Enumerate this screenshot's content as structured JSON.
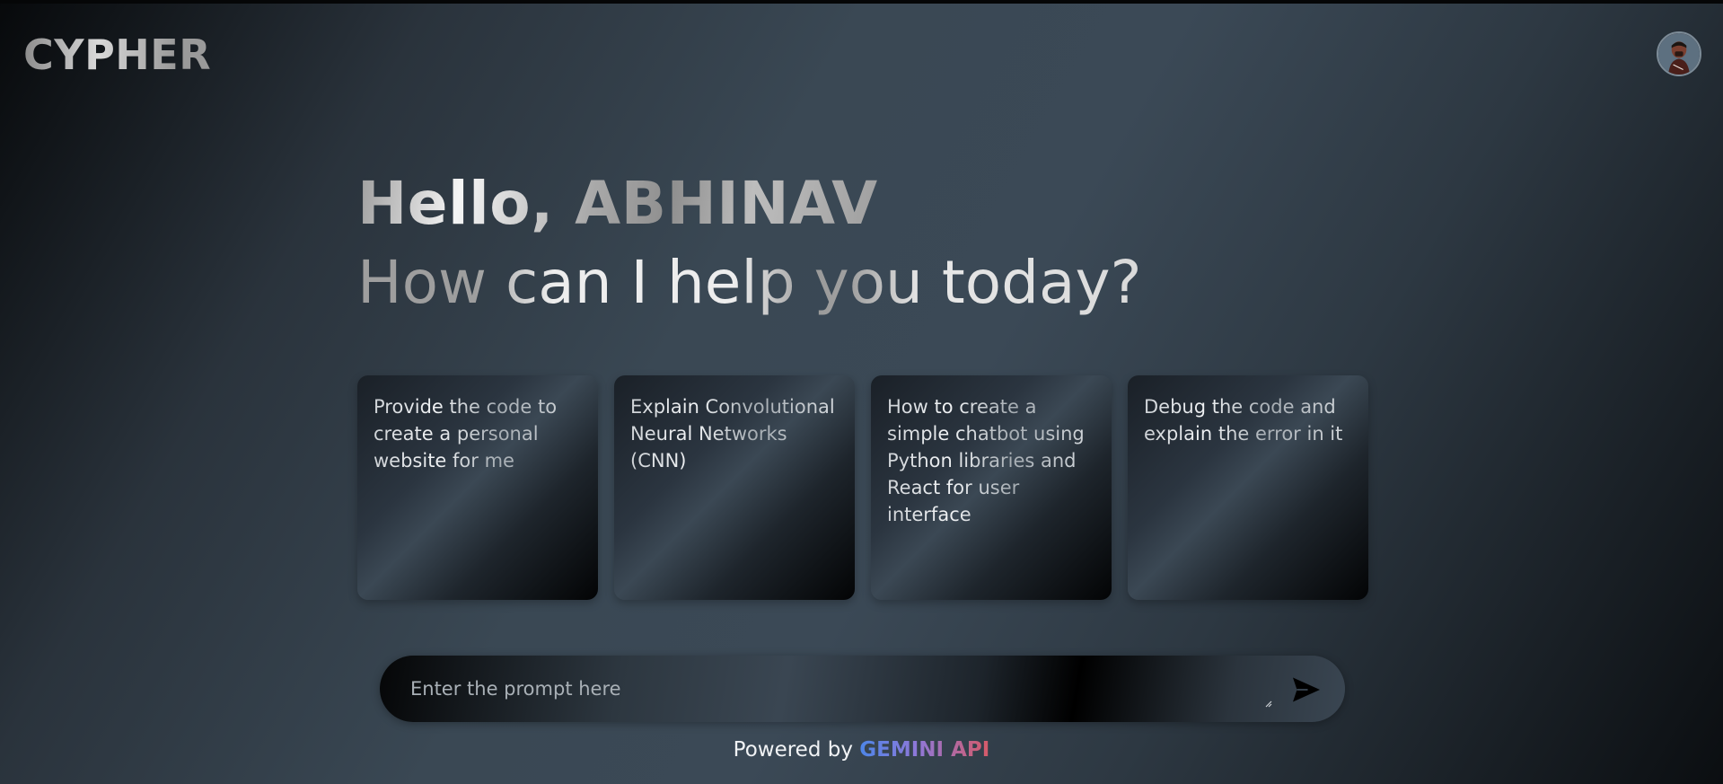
{
  "app": {
    "logo": "CYPHER"
  },
  "hero": {
    "greeting": "Hello, ABHINAV",
    "subtitle": "How can I help you today?"
  },
  "cards": [
    {
      "text": "Provide the code to create a personal website for me"
    },
    {
      "text": "Explain Convolutional Neural Networks (CNN)"
    },
    {
      "text": "How to create a simple chatbot using Python libraries and React for user interface"
    },
    {
      "text": "Debug the code and explain the error in it"
    }
  ],
  "prompt": {
    "placeholder": "Enter the prompt here",
    "value": ""
  },
  "footer": {
    "prefix": "Powered by ",
    "brand": "GEMINI API"
  },
  "colors": {
    "brand_gradient_start": "#4d86e8",
    "brand_gradient_mid": "#8f78d8",
    "brand_gradient_end": "#d65a68"
  },
  "icons": {
    "avatar": "user-avatar",
    "send": "send-icon",
    "resize": "resize-grip-icon"
  }
}
